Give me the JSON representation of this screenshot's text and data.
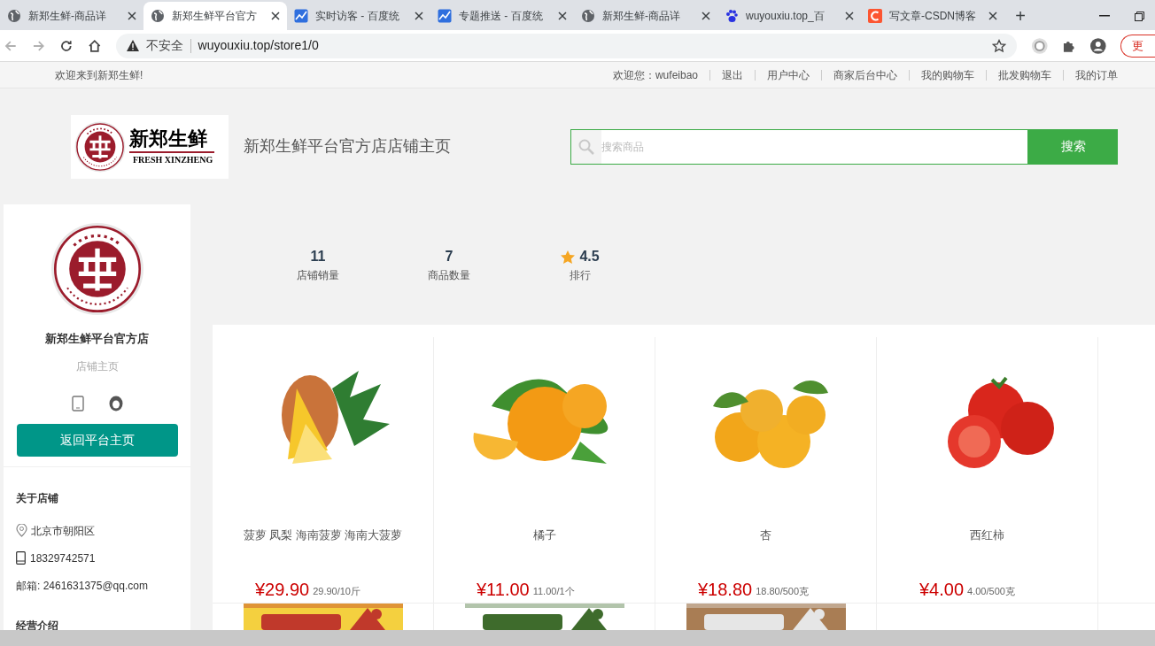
{
  "browser": {
    "tabs": [
      {
        "title": "新郑生鲜-商品详",
        "kind": "globe",
        "selected": false
      },
      {
        "title": "新郑生鲜平台官方",
        "kind": "globe",
        "selected": true
      },
      {
        "title": "实时访客 - 百度统",
        "kind": "chart",
        "selected": false
      },
      {
        "title": "专题推送 - 百度统",
        "kind": "chart",
        "selected": false
      },
      {
        "title": "新郑生鲜-商品详",
        "kind": "globe",
        "selected": false
      },
      {
        "title": "wuyouxiu.top_百",
        "kind": "paw",
        "selected": false
      },
      {
        "title": "写文章-CSDN博客",
        "kind": "csdn",
        "selected": false
      }
    ],
    "new_tab": "+",
    "security": "不安全",
    "url": "wuyouxiu.top/store1/0",
    "update_button": "更"
  },
  "top_bar": {
    "welcome": "欢迎来到新郑生鲜!",
    "links": [
      "欢迎您：wufeibao",
      "退出",
      "用户中心",
      "商家后台中心",
      "我的购物车",
      "批发购物车",
      "我的订单"
    ]
  },
  "header": {
    "logo_name": "新郑生鲜",
    "logo_subtitle": "FRESH XINZHENG",
    "title": "新郑生鲜平台官方店店铺主页",
    "search": {
      "placeholder": "搜索商品",
      "button": "搜索"
    }
  },
  "store": {
    "name": "新郑生鲜平台官方店",
    "subtitle": "店铺主页",
    "button": "返回平台主页",
    "about_title": "关于店铺",
    "address": "北京市朝阳区",
    "phone": "18329742571",
    "email": "邮箱: 2461631375@qq.com",
    "intro_title": "经营介绍"
  },
  "stats": [
    {
      "value": "11",
      "label": "店铺销量",
      "kind": "plain"
    },
    {
      "value": "7",
      "label": "商品数量",
      "kind": "plain"
    },
    {
      "value": "4.5",
      "label": "排行",
      "kind": "rating"
    }
  ],
  "products": [
    {
      "name": "菠萝 凤梨 海南菠萝 海南大菠萝",
      "price": "¥29.90",
      "unit": "29.90/10斤"
    },
    {
      "name": "橘子",
      "price": "¥11.00",
      "unit": "11.00/1个"
    },
    {
      "name": "杏",
      "price": "¥18.80",
      "unit": "18.80/500克"
    },
    {
      "name": "西红柿",
      "price": "¥4.00",
      "unit": "4.00/500克"
    }
  ],
  "more_products": [
    {
      "kind": "picture"
    },
    {
      "kind": "picture"
    },
    {
      "kind": "picture"
    },
    {
      "kind": "empty"
    }
  ]
}
